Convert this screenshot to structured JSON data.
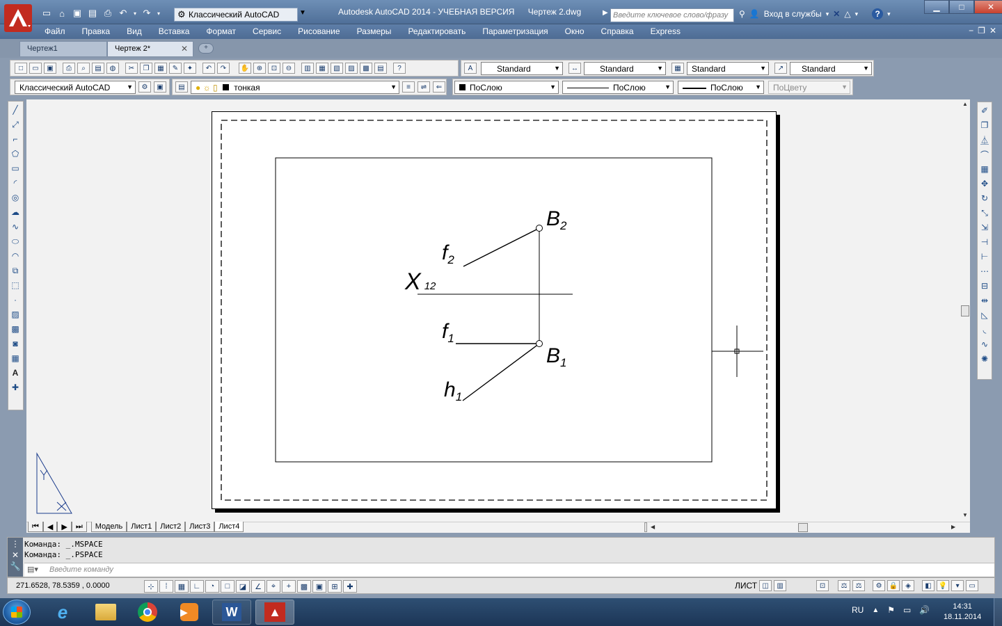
{
  "window": {
    "title": "Autodesk AutoCAD 2014 - УЧЕБНАЯ ВЕРСИЯ",
    "document": "Чертеж 2.dwg",
    "workspace": "Классический AutoCAD",
    "search_placeholder": "Введите ключевое слово/фразу",
    "signin": "Вход в службы",
    "controls": {
      "minimize": "▁",
      "maximize": "□",
      "close": "✕"
    }
  },
  "menu": [
    "Файл",
    "Правка",
    "Вид",
    "Вставка",
    "Формат",
    "Сервис",
    "Рисование",
    "Размеры",
    "Редактировать",
    "Параметризация",
    "Окно",
    "Справка",
    "Express"
  ],
  "file_tabs": [
    {
      "label": "Чертеж1",
      "active": false
    },
    {
      "label": "Чертеж 2*",
      "active": true
    }
  ],
  "styles_toolbar": {
    "text_style": "Standard",
    "dim_style": "Standard",
    "table_style": "Standard",
    "mleader_style": "Standard"
  },
  "layers_toolbar": {
    "workspace": "Классический AutoCAD",
    "layer": "тонкая",
    "color": "ПоСлою",
    "linetype": "ПоСлою",
    "lineweight": "ПоСлою",
    "plotstyle": "ПоЦвету"
  },
  "drawing": {
    "labels": {
      "B2": "B",
      "B2_sub": "2",
      "f2": "f",
      "f2_sub": "2",
      "X12": "X",
      "X12_sub": "12",
      "f1": "f",
      "f1_sub": "1",
      "B1": "B",
      "B1_sub": "1",
      "h1": "h",
      "h1_sub": "1"
    }
  },
  "layout_tabs": [
    {
      "label": "Модель",
      "active": false
    },
    {
      "label": "Лист1",
      "active": false
    },
    {
      "label": "Лист2",
      "active": false
    },
    {
      "label": "Лист3",
      "active": false
    },
    {
      "label": "Лист4",
      "active": true
    }
  ],
  "command": {
    "history": [
      "Команда:  _.MSPACE",
      "Команда:  _.PSPACE"
    ],
    "input_placeholder": "Введите команду"
  },
  "status": {
    "coordinates": "271.6528, 78.5359 , 0.0000",
    "space": "ЛИСТ"
  },
  "taskbar": {
    "lang": "RU",
    "time": "14:31",
    "date": "18.11.2014"
  }
}
